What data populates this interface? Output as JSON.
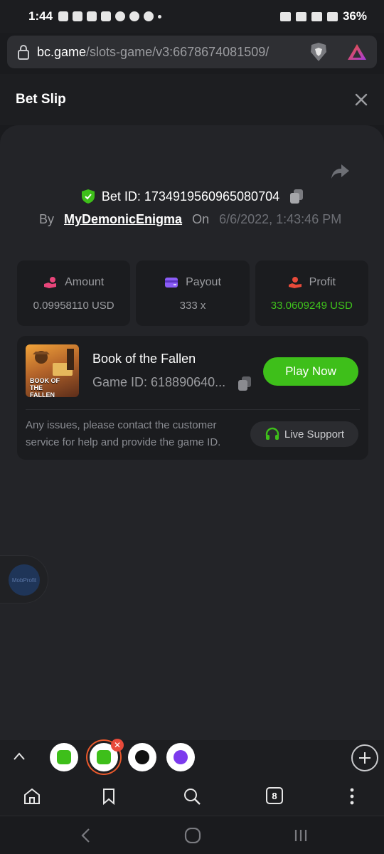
{
  "status_bar": {
    "time": "1:44",
    "battery": "36%"
  },
  "url_bar": {
    "domain": "bc.game",
    "path": "/slots-game/v3:6678674081509/"
  },
  "modal": {
    "title": "Bet Slip"
  },
  "bet": {
    "bet_id_label": "Bet ID: 1734919560965080704",
    "by_label": "By",
    "username": "MyDemonicEnigma",
    "on_label": "On",
    "date": "6/6/2022, 1:43:46 PM"
  },
  "stats": [
    {
      "label": "Amount",
      "value": "0.09958110 USD",
      "icon": "money-hand-icon",
      "color": "#e8457a"
    },
    {
      "label": "Payout",
      "value": "333 x",
      "icon": "wallet-icon",
      "color": "#8b5cf6"
    },
    {
      "label": "Profit",
      "value": "33.0609249 USD",
      "icon": "profit-hand-icon",
      "color": "#e84a3a"
    }
  ],
  "game": {
    "name": "Book of the Fallen",
    "game_id": "Game ID: 618890640...",
    "thumb_text": "BOOK OF THE FALLEN",
    "play_label": "Play Now",
    "support_text": "Any issues, please contact the customer service for help and provide the game ID.",
    "live_support_label": "Live Support"
  },
  "float_widget": {
    "label": "MobProfit"
  },
  "toolbar": {
    "tab_count": "8"
  },
  "colors": {
    "accent_green": "#3ebf1a",
    "profit_green": "#3fc31c",
    "background": "#1a1b1e",
    "panel": "#232428",
    "card": "#1b1c1f"
  }
}
